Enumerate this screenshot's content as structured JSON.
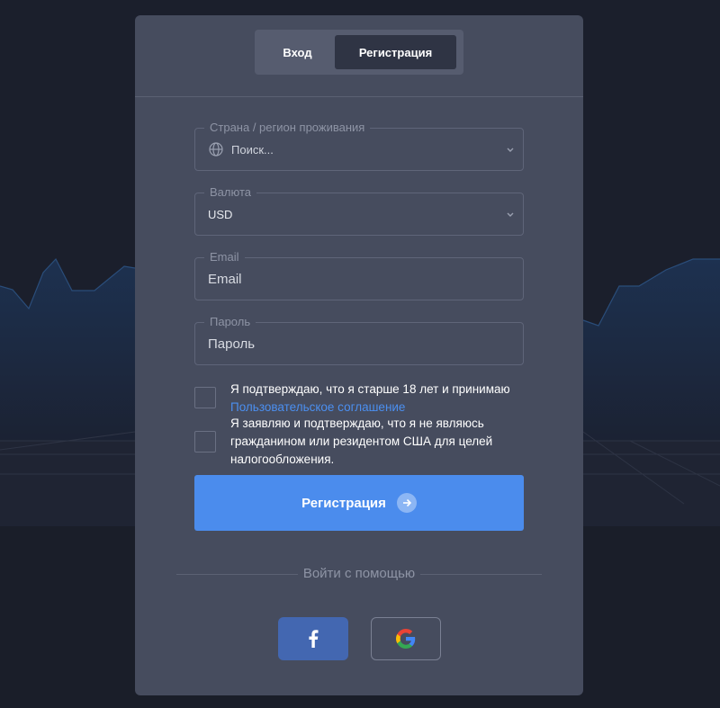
{
  "tabs": {
    "login_label": "Вход",
    "register_label": "Регистрация",
    "active": "register"
  },
  "form": {
    "country": {
      "label": "Страна / регион проживания",
      "placeholder": "Поиск..."
    },
    "currency": {
      "label": "Валюта",
      "value": "USD"
    },
    "email": {
      "label": "Email",
      "placeholder": "Email"
    },
    "password": {
      "label": "Пароль",
      "placeholder": "Пароль"
    },
    "age_consent": {
      "text": "Я подтверждаю, что я старше 18 лет и принимаю",
      "link_text": "Пользовательское соглашение",
      "checked": false
    },
    "us_declaration": {
      "text": "Я заявляю и подтверждаю, что я не являюсь гражданином или резидентом США для целей налогообложения.",
      "checked": false
    },
    "submit_label": "Регистрация"
  },
  "social": {
    "divider_text": "Войти с помощью",
    "providers": [
      "facebook",
      "google"
    ]
  },
  "colors": {
    "page_bg": "#1b1f2c",
    "card_bg": "#464c5e",
    "accent": "#4b8ced",
    "link": "#4b8ff0",
    "facebook": "#4367b1"
  }
}
